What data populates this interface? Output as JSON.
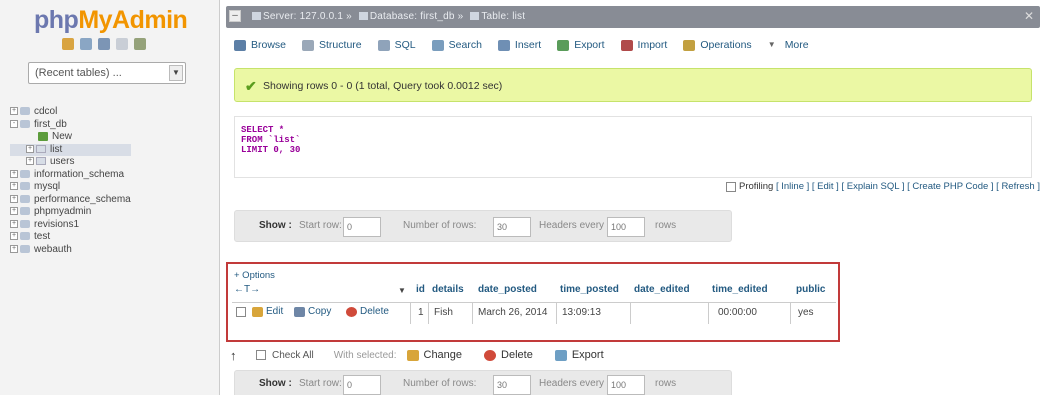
{
  "logo": {
    "part1": "php",
    "part2": "MyAdmin"
  },
  "recent_tables": {
    "value": "(Recent tables) ..."
  },
  "tree": [
    {
      "name": "cdcol",
      "level": 1,
      "expander": "+"
    },
    {
      "name": "first_db",
      "level": 1,
      "expander": "-"
    },
    {
      "name": "New",
      "level": 2,
      "expander": ""
    },
    {
      "name": "list",
      "level": 2,
      "expander": "+",
      "selected": true
    },
    {
      "name": "users",
      "level": 2,
      "expander": "+"
    },
    {
      "name": "information_schema",
      "level": 1,
      "expander": "+"
    },
    {
      "name": "mysql",
      "level": 1,
      "expander": "+"
    },
    {
      "name": "performance_schema",
      "level": 1,
      "expander": "+"
    },
    {
      "name": "phpmyadmin",
      "level": 1,
      "expander": "+"
    },
    {
      "name": "revisions1",
      "level": 1,
      "expander": "+"
    },
    {
      "name": "test",
      "level": 1,
      "expander": "+"
    },
    {
      "name": "webauth",
      "level": 1,
      "expander": "+"
    }
  ],
  "breadcrumb": {
    "server": "Server: 127.0.0.1",
    "database": "Database: first_db",
    "table": "Table: list"
  },
  "tabs": [
    {
      "label": "Browse",
      "icon": "browse-icon",
      "color": "#5c7fa6"
    },
    {
      "label": "Structure",
      "icon": "structure-icon",
      "color": "#9aa8b8"
    },
    {
      "label": "SQL",
      "icon": "sql-icon",
      "color": "#8fa3ba"
    },
    {
      "label": "Search",
      "icon": "search-icon",
      "color": "#7a9dbd"
    },
    {
      "label": "Insert",
      "icon": "insert-icon",
      "color": "#6f8fb4"
    },
    {
      "label": "Export",
      "icon": "export-icon",
      "color": "#5a9c5a"
    },
    {
      "label": "Import",
      "icon": "import-icon",
      "color": "#b04a4a"
    },
    {
      "label": "Operations",
      "icon": "operations-icon",
      "color": "#c2a040"
    },
    {
      "label": "More",
      "icon": "chevron-down-icon",
      "color": "#666666"
    }
  ],
  "success": {
    "message": "Showing rows 0 - 0 (1 total, Query took 0.0012 sec)"
  },
  "sql": {
    "line1": "SELECT *",
    "line2": "FROM `list`",
    "line3": "LIMIT 0, 30"
  },
  "profiling": {
    "label": "Profiling",
    "links": "[ Inline ] [ Edit ] [ Explain SQL ] [ Create PHP Code ] [ Refresh ]"
  },
  "nav_controls": {
    "show": "Show :",
    "start_row_label": "Start row:",
    "start_row_value": "0",
    "num_rows_label": "Number of rows:",
    "num_rows_value": "30",
    "headers_every_label": "Headers every",
    "headers_every_value": "100",
    "rows_label": "rows"
  },
  "results": {
    "options_link": "+ Options",
    "arrows": "←T→",
    "columns": [
      "id",
      "details",
      "date_posted",
      "time_posted",
      "date_edited",
      "time_edited",
      "public"
    ],
    "row": {
      "edit": "Edit",
      "copy": "Copy",
      "delete": "Delete",
      "values": [
        "1",
        "Fish",
        "March 26, 2014",
        "13:09:13",
        "",
        "00:00:00",
        "yes"
      ]
    }
  },
  "bulk_actions": {
    "check_all": "Check All",
    "with_selected": "With selected:",
    "change": "Change",
    "delete": "Delete",
    "export": "Export"
  },
  "colors": {
    "accent": "#235a81",
    "success_bg": "#ebf8a4",
    "highlight_border": "#c23a3a"
  }
}
